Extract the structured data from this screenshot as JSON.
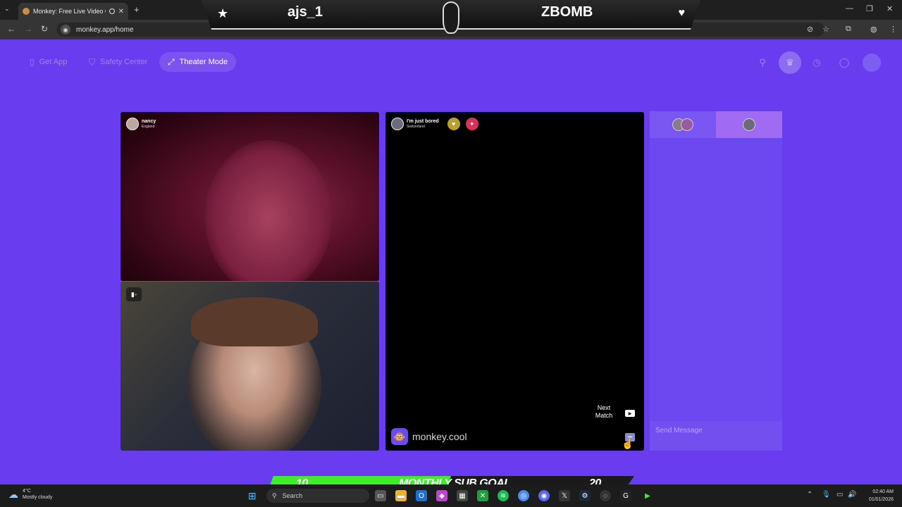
{
  "browser": {
    "tab_title": "Monkey: Free Live Video Ch",
    "url": "monkey.app/home"
  },
  "overlay": {
    "left_name": "ajs_1",
    "right_name": "ZBOMB"
  },
  "nav": {
    "get_app": "Get App",
    "safety_center": "Safety Center",
    "theater_mode": "Theater Mode"
  },
  "tiles": {
    "partner_a": {
      "name": "nancy",
      "country": "England"
    },
    "partner_b": {
      "name": "I'm just bored",
      "country": "Switzerland"
    },
    "next_match": "Next Match",
    "brand": "monkey.cool"
  },
  "chat": {
    "placeholder": "Send Message"
  },
  "sub_goal": {
    "current": "10",
    "label": "MONTHLY SUB GOAL",
    "target": "20",
    "progress": 0.5
  },
  "taskbar": {
    "temp": "4°C",
    "weather": "Mostly cloudy",
    "search": "Search",
    "time": "02:40 AM",
    "date": "01/01/2026"
  },
  "colors": {
    "page_bg": "#6a3cf0",
    "goal_fill": "#3cef2a"
  }
}
